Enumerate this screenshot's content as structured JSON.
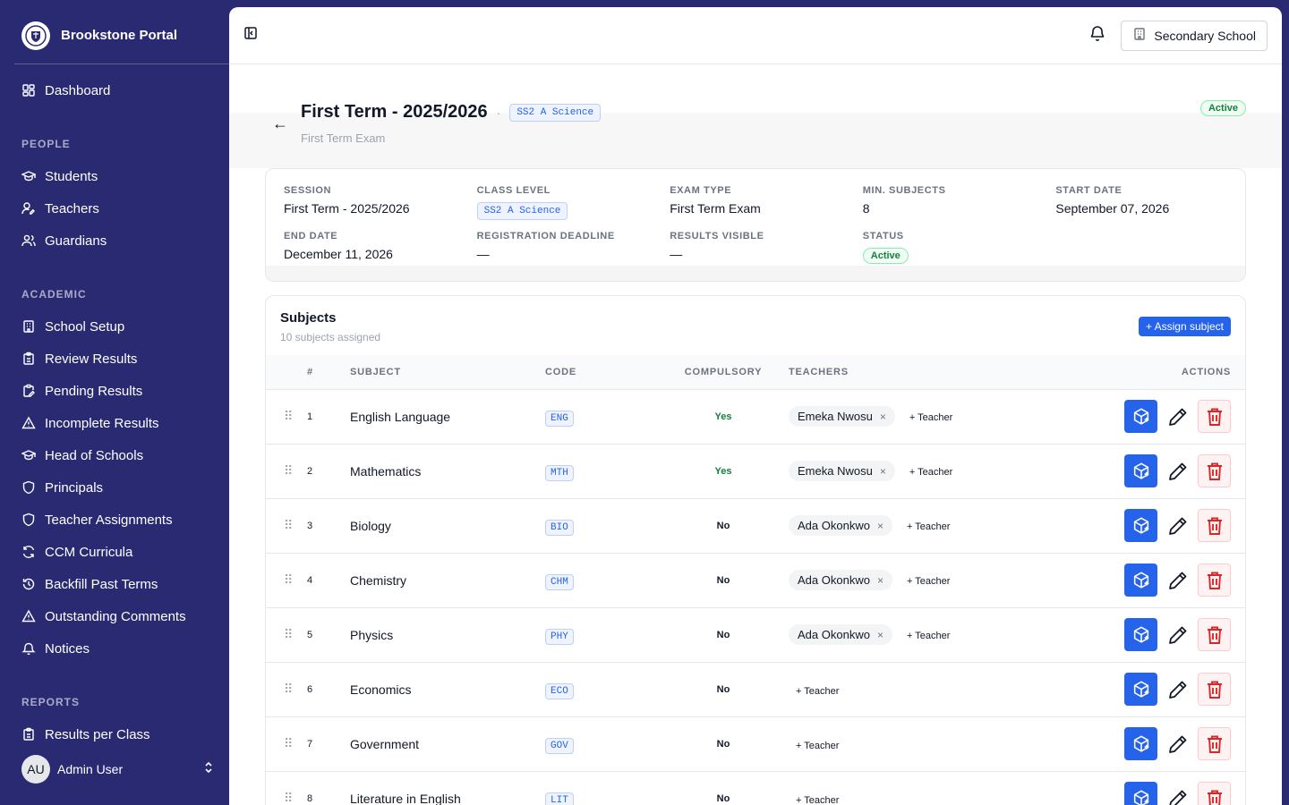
{
  "app": {
    "name": "Brookstone Portal"
  },
  "sidebar": {
    "items_top": [
      {
        "label": "Dashboard",
        "icon": "dashboard-icon"
      }
    ],
    "sections": [
      {
        "title": "PEOPLE",
        "items": [
          {
            "label": "Students",
            "icon": "graduation-cap-icon"
          },
          {
            "label": "Teachers",
            "icon": "user-pen-icon"
          },
          {
            "label": "Guardians",
            "icon": "users-icon"
          }
        ]
      },
      {
        "title": "ACADEMIC",
        "items": [
          {
            "label": "School Setup",
            "icon": "building-icon"
          },
          {
            "label": "Review Results",
            "icon": "clipboard-icon"
          },
          {
            "label": "Pending Results",
            "icon": "clipboard-pen-icon"
          },
          {
            "label": "Incomplete Results",
            "icon": "warning-triangle-icon"
          },
          {
            "label": "Head of Schools",
            "icon": "graduation-cap-icon"
          },
          {
            "label": "Principals",
            "icon": "shield-icon"
          },
          {
            "label": "Teacher Assignments",
            "icon": "shield-icon"
          },
          {
            "label": "CCM Curricula",
            "icon": "refresh-icon"
          },
          {
            "label": "Backfill Past Terms",
            "icon": "history-icon"
          },
          {
            "label": "Outstanding Comments",
            "icon": "warning-triangle-icon"
          },
          {
            "label": "Notices",
            "icon": "bell-icon"
          }
        ]
      },
      {
        "title": "REPORTS",
        "items": [
          {
            "label": "Results per Class",
            "icon": "clipboard-icon"
          }
        ]
      }
    ],
    "user": {
      "initials": "AU",
      "name": "Admin User"
    }
  },
  "topbar": {
    "school_button": "Secondary School"
  },
  "header": {
    "title": "First Term - 2025/2026",
    "separator": "·",
    "class_chip": "SS2 A Science",
    "subtitle": "First Term Exam",
    "status": "Active",
    "back": "←"
  },
  "details": [
    {
      "label": "SESSION",
      "value": "First Term - 2025/2026",
      "kind": "text"
    },
    {
      "label": "CLASS LEVEL",
      "value": "SS2 A Science",
      "kind": "chip"
    },
    {
      "label": "EXAM TYPE",
      "value": "First Term Exam",
      "kind": "text"
    },
    {
      "label": "MIN. SUBJECTS",
      "value": "8",
      "kind": "text"
    },
    {
      "label": "START DATE",
      "value": "September 07, 2026",
      "kind": "text"
    },
    {
      "label": "END DATE",
      "value": "December 11, 2026",
      "kind": "text"
    },
    {
      "label": "REGISTRATION DEADLINE",
      "value": "—",
      "kind": "text"
    },
    {
      "label": "RESULTS VISIBLE",
      "value": "—",
      "kind": "text"
    },
    {
      "label": "STATUS",
      "value": "Active",
      "kind": "badge"
    }
  ],
  "subjects": {
    "title": "Subjects",
    "count_text": "10 subjects assigned",
    "assign_label": "+ Assign subject",
    "add_teacher_label": "+ Teacher",
    "remove_glyph": "×",
    "drag_glyph": "⠿",
    "columns": {
      "num": "#",
      "subject": "SUBJECT",
      "code": "CODE",
      "compulsory": "COMPULSORY",
      "teachers": "TEACHERS",
      "actions": "ACTIONS"
    },
    "rows": [
      {
        "num": "1",
        "subject": "English Language",
        "code": "ENG",
        "compulsory": "Yes",
        "teachers": [
          "Emeka Nwosu"
        ]
      },
      {
        "num": "2",
        "subject": "Mathematics",
        "code": "MTH",
        "compulsory": "Yes",
        "teachers": [
          "Emeka Nwosu"
        ]
      },
      {
        "num": "3",
        "subject": "Biology",
        "code": "BIO",
        "compulsory": "No",
        "teachers": [
          "Ada Okonkwo"
        ]
      },
      {
        "num": "4",
        "subject": "Chemistry",
        "code": "CHM",
        "compulsory": "No",
        "teachers": [
          "Ada Okonkwo"
        ]
      },
      {
        "num": "5",
        "subject": "Physics",
        "code": "PHY",
        "compulsory": "No",
        "teachers": [
          "Ada Okonkwo"
        ]
      },
      {
        "num": "6",
        "subject": "Economics",
        "code": "ECO",
        "compulsory": "No",
        "teachers": []
      },
      {
        "num": "7",
        "subject": "Government",
        "code": "GOV",
        "compulsory": "No",
        "teachers": []
      },
      {
        "num": "8",
        "subject": "Literature in English",
        "code": "LIT",
        "compulsory": "No",
        "teachers": []
      }
    ]
  },
  "colors": {
    "sidebar": "#2a2a73",
    "accent": "#2563eb",
    "success": "#15803d",
    "danger": "#dc2626"
  }
}
